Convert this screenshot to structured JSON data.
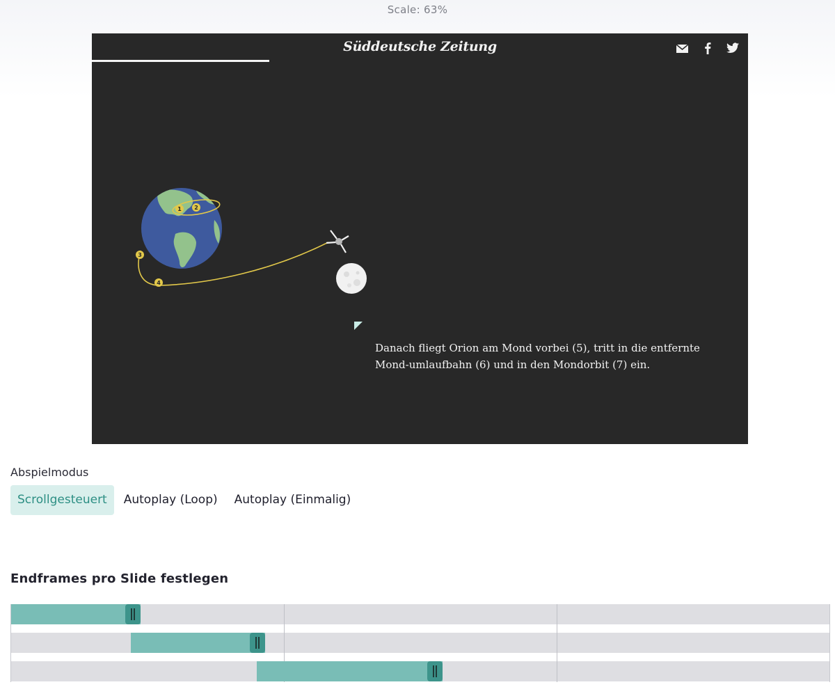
{
  "header": {
    "scale_label": "Scale: 63%"
  },
  "preview": {
    "logo": "Süddeutsche Zeitung",
    "progress_fraction": 0.27,
    "share_icons": [
      "mail-icon",
      "facebook-icon",
      "twitter-icon"
    ],
    "orbit_points": [
      "1",
      "2",
      "3",
      "4"
    ],
    "caption": "Danach fliegt Orion am Mond vorbei (5), tritt in die entfernte Mond-umlaufbahn (6) und in den Mondorbit (7) ein."
  },
  "play_mode": {
    "label": "Abspielmodus",
    "options": [
      "Scrollgesteuert",
      "Autoplay (Loop)",
      "Autoplay (Einmalig)"
    ],
    "selected": "Scrollgesteuert"
  },
  "endframes": {
    "title": "Endframes pro Slide festlegen",
    "slides": [
      {
        "start": 0.0,
        "end": 0.158
      },
      {
        "start": 0.146,
        "end": 0.31
      },
      {
        "start": 0.3,
        "end": 0.527
      }
    ]
  },
  "colors": {
    "accent": "#2d8f84",
    "accent_bg": "#d9efec",
    "bar": "#79bdb6",
    "handle": "#3d948b",
    "preview_bg": "#282828"
  }
}
